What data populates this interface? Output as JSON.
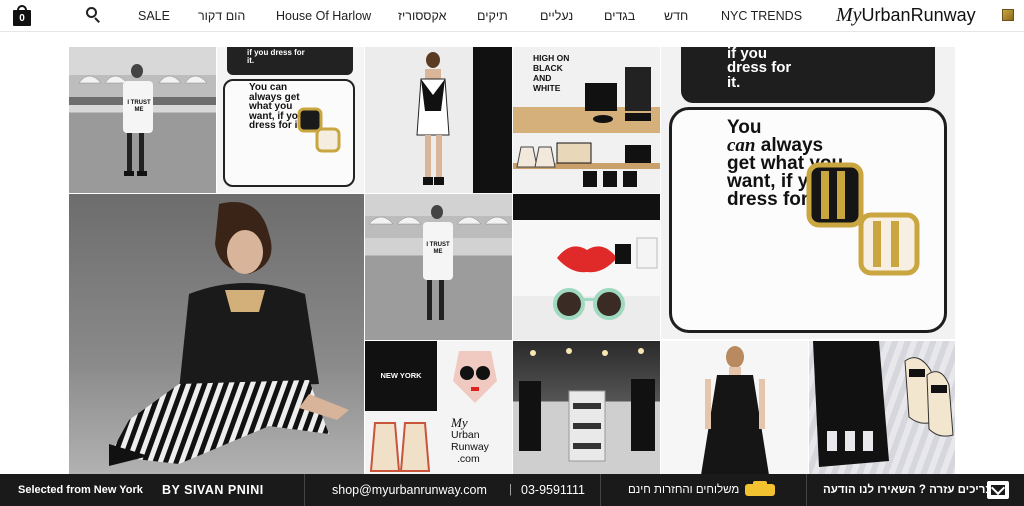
{
  "header": {
    "cart_count": "0",
    "nav": {
      "sale": "SALE",
      "home_decor": "הום דקור",
      "house_of_harlow": "House Of Harlow",
      "accessories": "אקססוריז",
      "bags": "תיקים",
      "shoes": "נעליים",
      "clothes": "בגדים",
      "new": "חדש",
      "nyc_trends": "NYC TRENDS"
    },
    "logo": {
      "my": "My",
      "rest": "UrbanRunway"
    }
  },
  "tiles": {
    "trust_me_top": {
      "shirt": "I TRUST ME"
    },
    "coaster_small": {
      "top": "if you dress for it.",
      "body": "You can always get what you want, if you dress for it."
    },
    "high_on_black": {
      "sign": "HIGH ON BLACK AND WHITE"
    },
    "coaster_large": {
      "top": "if you dress for it.",
      "body_1": "You",
      "body_can": "can",
      "body_2": "always get what you want, if you dress for it."
    },
    "trust_me_mid": {
      "shirt": "I TRUST ME"
    },
    "new_york": {
      "label": "NEW YORK"
    },
    "logo_tile": {
      "my": "My",
      "line1": "Urban",
      "line2": "Runway",
      "line3": ".com"
    }
  },
  "footer": {
    "selected_from": "Selected from New York",
    "by": "BY SIVAN PNINI",
    "email": "shop@myurbanrunway.com",
    "phone_sep": "|",
    "phone": "03-9591111",
    "shipping": "משלוחים והחזרות חינם",
    "help": "צריכים עזרה ? השאירו לנו הודעה"
  },
  "colors": {
    "footer_bg": "#1a1a1a",
    "taxi": "#f2c230",
    "lips": "#e02a2a",
    "mint": "#9fd9c0"
  }
}
